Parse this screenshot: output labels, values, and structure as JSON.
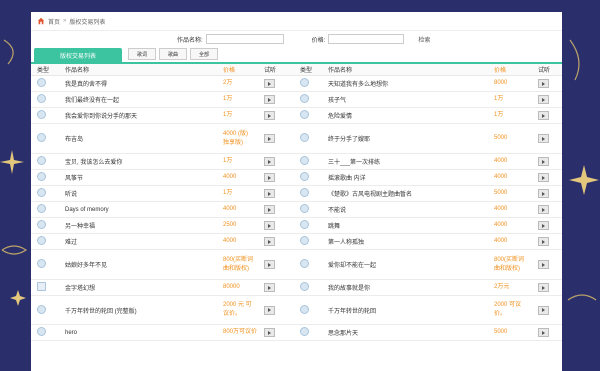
{
  "breadcrumb": {
    "home": "首页",
    "sep": "»",
    "current": "版权交易列表"
  },
  "search": {
    "title_label": "作品名称:",
    "price_label": "价格:",
    "search_btn": "检索"
  },
  "tabs": {
    "active": "版权交易列表",
    "buttons": [
      "歌词",
      "歌曲",
      "全部"
    ]
  },
  "columns": {
    "type": "类型",
    "name": "作品名称",
    "price": "价格",
    "audition": "试听"
  },
  "rows": [
    {
      "left": {
        "icon": "disc-icon",
        "name": "我是真的舍不得",
        "price": "2万"
      },
      "right": {
        "icon": "disc-icon",
        "name": "天知道我有多么地想你",
        "price": "8000"
      }
    },
    {
      "left": {
        "icon": "disc-icon",
        "name": "我们最终没有在一起",
        "price": "1万"
      },
      "right": {
        "icon": "disc-icon",
        "name": "孩子气",
        "price": "1万"
      }
    },
    {
      "left": {
        "icon": "disc-icon",
        "name": "我会爱你到你说分手的那天",
        "price": "1万"
      },
      "right": {
        "icon": "disc-icon",
        "name": "危险爱情",
        "price": "1万"
      }
    },
    {
      "left": {
        "icon": "disc-icon",
        "name": "布吉岛",
        "price": "4000 (版)\n独享版)"
      },
      "right": {
        "icon": "disc-icon",
        "name": "终于分手了嫂耶",
        "price": "5000"
      }
    },
    {
      "left": {
        "icon": "disc-icon",
        "name": "宝贝, 我该怎么去爱你",
        "price": "1万"
      },
      "right": {
        "icon": "disc-icon",
        "name": "三十___第一次排练",
        "price": "4000"
      }
    },
    {
      "left": {
        "icon": "disc-icon",
        "name": "风筝节",
        "price": "4000"
      },
      "right": {
        "icon": "disc-icon",
        "name": "摇滚歌曲 内详",
        "price": "4000"
      }
    },
    {
      "left": {
        "icon": "disc-icon",
        "name": "听说",
        "price": "1万"
      },
      "right": {
        "icon": "disc-icon",
        "name": "《楚歌》古风电视剧主题曲暂名",
        "price": "5000"
      }
    },
    {
      "left": {
        "icon": "disc-icon",
        "name": "Days of memory",
        "price": "4000"
      },
      "right": {
        "icon": "disc-icon",
        "name": "不能说",
        "price": "4000"
      }
    },
    {
      "left": {
        "icon": "disc-icon",
        "name": "另一种幸福",
        "price": "2500"
      },
      "right": {
        "icon": "disc-icon",
        "name": "跳舞",
        "price": "4000"
      }
    },
    {
      "left": {
        "icon": "disc-icon",
        "name": "难过",
        "price": "4000"
      },
      "right": {
        "icon": "disc-icon",
        "name": "第一人称孤独",
        "price": "4000"
      }
    },
    {
      "left": {
        "icon": "disc-icon",
        "name": "姑娘好多年不见",
        "price": "800(买断词\n曲和版权)"
      },
      "right": {
        "icon": "disc-icon",
        "name": "爱你却不能在一起",
        "price": "800(买断词\n曲和版权)"
      }
    },
    {
      "left": {
        "icon": "doc-icon",
        "name": "金字塔幻想",
        "price": "80000"
      },
      "right": {
        "icon": "disc-icon",
        "name": "我的故事就是你",
        "price": "2万元"
      }
    },
    {
      "left": {
        "icon": "disc-icon",
        "name": "千万年转世的轮回 (完整版)",
        "price": "2000 元 可\n议价。"
      },
      "right": {
        "icon": "disc-icon",
        "name": "千万年转世的轮回",
        "price": "2000 可议\n价。"
      }
    },
    {
      "left": {
        "icon": "disc-icon",
        "name": "hero",
        "price": "800万可议价"
      },
      "right": {
        "icon": "disc-icon",
        "name": "思念那片天",
        "price": "5000"
      }
    }
  ],
  "colors": {
    "accent": "#3cc3a0",
    "price": "#f0901e",
    "background": "#2a2f6b"
  }
}
